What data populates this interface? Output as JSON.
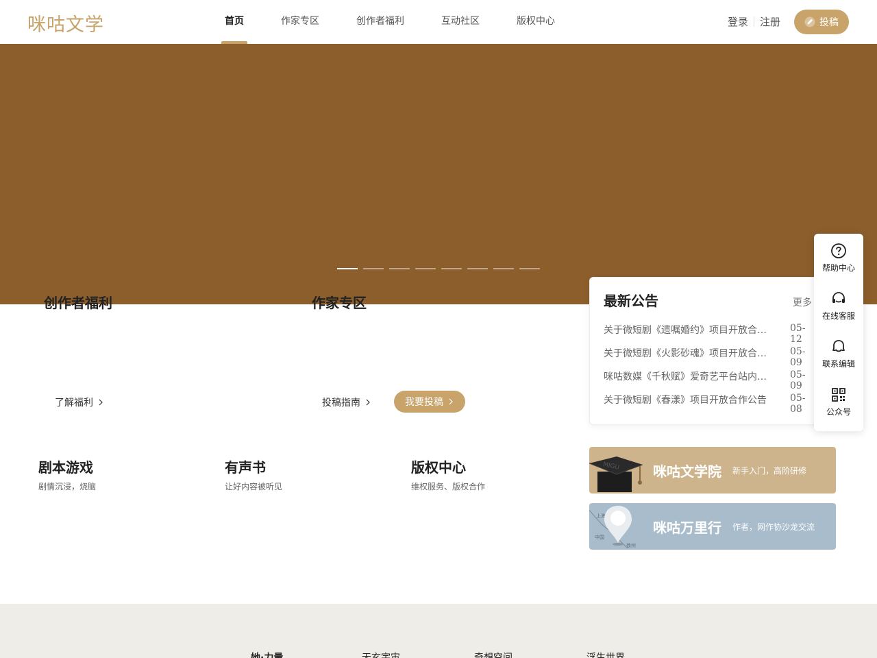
{
  "header": {
    "logo": "咪咕文学",
    "nav": [
      {
        "label": "首页",
        "active": true
      },
      {
        "label": "作家专区",
        "active": false
      },
      {
        "label": "创作者福利",
        "active": false
      },
      {
        "label": "互动社区",
        "active": false
      },
      {
        "label": "版权中心",
        "active": false
      }
    ],
    "login": "登录",
    "register": "注册",
    "submit_label": "投稿"
  },
  "banner": {
    "color": "#8b5e2c",
    "slide_count": 8,
    "active_slide": 1
  },
  "features": {
    "welfare": {
      "title": "创作者福利",
      "link": "了解福利"
    },
    "writer": {
      "title": "作家专区",
      "guide": "投稿指南",
      "submit": "我要投稿"
    }
  },
  "notice": {
    "title": "最新公告",
    "more": "更多",
    "items": [
      {
        "text": "关于微短剧《遗嘱婚约》项目开放合作公告",
        "date": "05-12"
      },
      {
        "text": "关于微短剧《火影砂魂》项目开放合作公告",
        "date": "05-09"
      },
      {
        "text": "咪咕数媒《千秋赋》爱奇艺平台站内上线公告",
        "date": "05-09"
      },
      {
        "text": "关于微短剧《春漾》项目开放合作公告",
        "date": "05-08"
      }
    ]
  },
  "float_bar": [
    {
      "label": "帮助中心",
      "icon": "help-icon"
    },
    {
      "label": "在线客服",
      "icon": "headset-icon"
    },
    {
      "label": "联系编辑",
      "icon": "chat-icon"
    },
    {
      "label": "公众号",
      "icon": "qrcode-icon"
    }
  ],
  "categories": [
    {
      "title": "剧本游戏",
      "subtitle": "剧情沉浸，烧脑"
    },
    {
      "title": "有声书",
      "subtitle": "让好内容被听见"
    },
    {
      "title": "版权中心",
      "subtitle": "维权服务、版权合作"
    }
  ],
  "promos": {
    "academy": {
      "title": "咪咕文学院",
      "subtitle": "新手入门，高阶研修",
      "color": "#cdb48c",
      "art_text": "MIGU"
    },
    "tour": {
      "title": "咪咕万里行",
      "subtitle": "作者，网作协沙龙交流",
      "color": "#a8bccb",
      "map_labels": [
        "上海",
        "中国",
        "徐州"
      ]
    }
  },
  "footer": {
    "links": [
      "她·力量",
      "无玄宇宙",
      "奇想空间",
      "浮生世界"
    ]
  },
  "colors": {
    "accent": "#c8a36a",
    "footer_bg": "#efede8"
  }
}
